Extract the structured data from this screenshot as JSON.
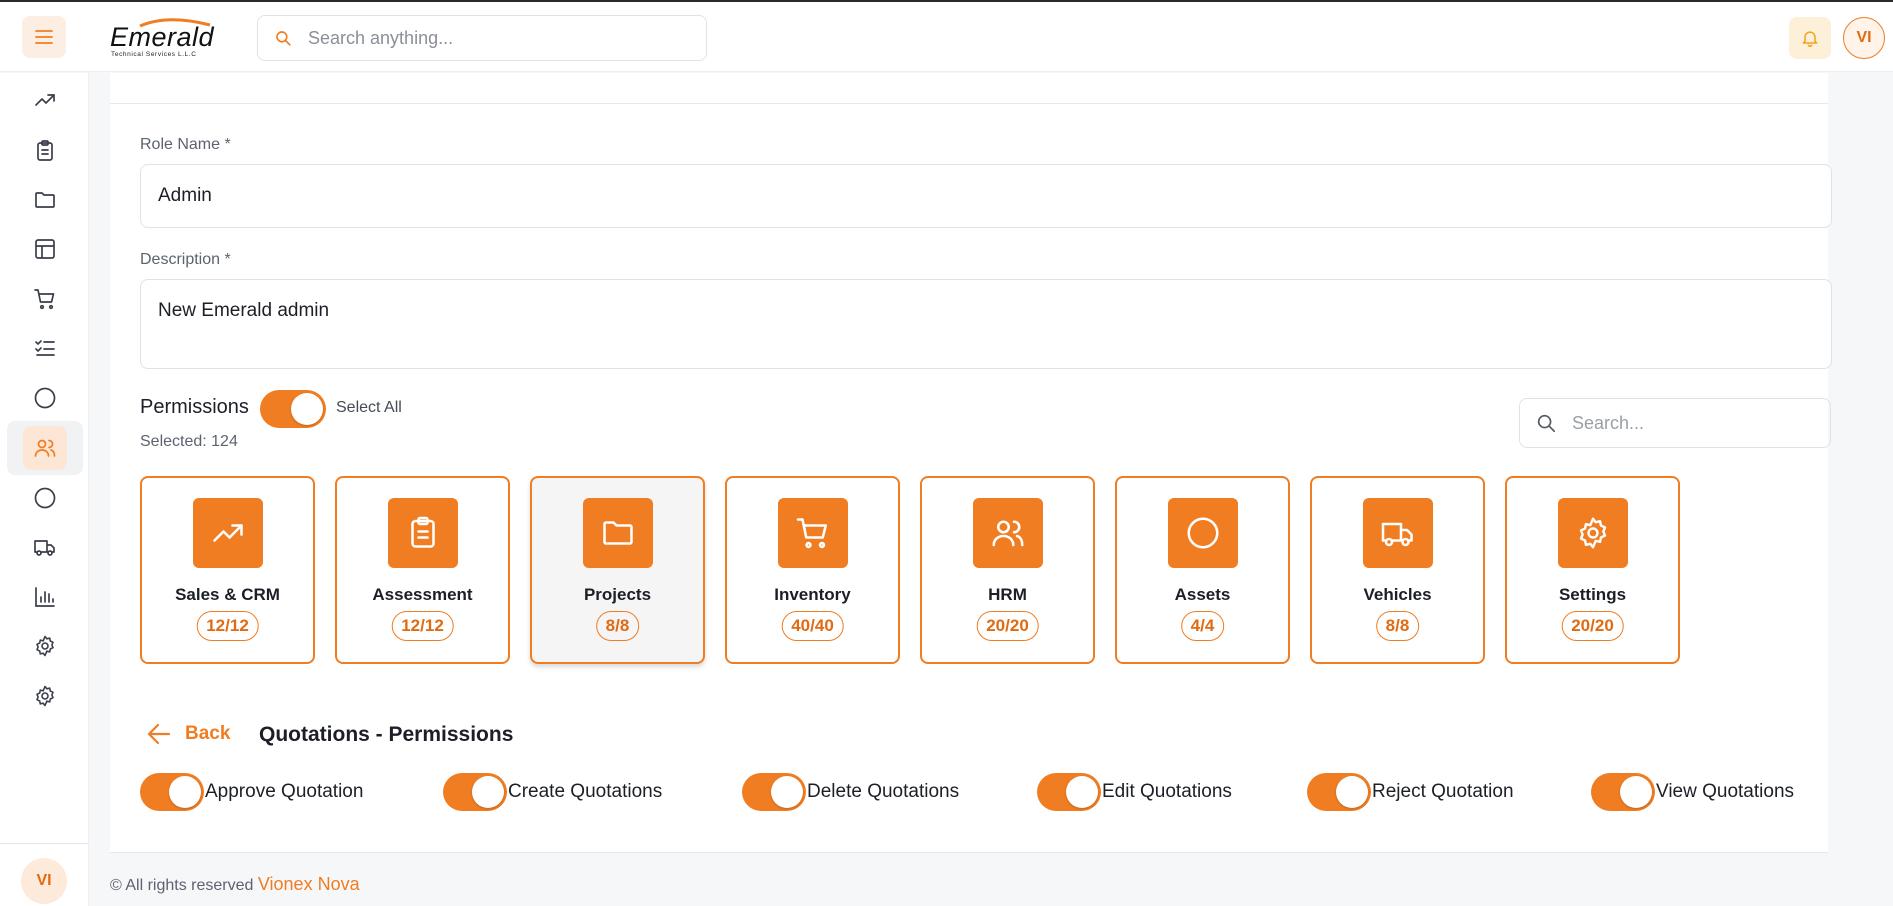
{
  "header": {
    "logo_text": "Emerald",
    "logo_sub": "Technical Services L.L.C",
    "search_placeholder": "Search anything...",
    "user_initials": "VI"
  },
  "sidebar": {
    "items": [
      {
        "icon": "trending-up-icon"
      },
      {
        "icon": "clipboard-icon"
      },
      {
        "icon": "folder-icon"
      },
      {
        "icon": "layout-icon"
      },
      {
        "icon": "cart-icon"
      },
      {
        "icon": "checklist-icon"
      },
      {
        "icon": "circle-icon"
      },
      {
        "icon": "users-icon",
        "active": true
      },
      {
        "icon": "circle-icon"
      },
      {
        "icon": "truck-icon"
      },
      {
        "icon": "bar-chart-icon"
      },
      {
        "icon": "gear-icon"
      },
      {
        "icon": "gear-icon"
      }
    ],
    "user_initials": "VI"
  },
  "form": {
    "role_name_label": "Role Name *",
    "role_name_value": "Admin",
    "description_label": "Description *",
    "description_value": "New Emerald admin",
    "permissions_label": "Permissions",
    "select_all_label": "Select All",
    "selected_text": "Selected: 124",
    "search_placeholder": "Search..."
  },
  "modules": [
    {
      "name": "Sales & CRM",
      "count": "12/12",
      "icon": "trending-up-icon"
    },
    {
      "name": "Assessment",
      "count": "12/12",
      "icon": "clipboard-icon"
    },
    {
      "name": "Projects",
      "count": "8/8",
      "icon": "folder-icon",
      "active": true
    },
    {
      "name": "Inventory",
      "count": "40/40",
      "icon": "cart-icon"
    },
    {
      "name": "HRM",
      "count": "20/20",
      "icon": "users-icon"
    },
    {
      "name": "Assets",
      "count": "4/4",
      "icon": "circle-icon"
    },
    {
      "name": "Vehicles",
      "count": "8/8",
      "icon": "truck-icon"
    },
    {
      "name": "Settings",
      "count": "20/20",
      "icon": "gear-icon"
    }
  ],
  "detail": {
    "back_label": "Back",
    "title": "Quotations - Permissions",
    "permissions": [
      {
        "label": "Approve Quotation",
        "enabled": true
      },
      {
        "label": "Create Quotations",
        "enabled": true
      },
      {
        "label": "Delete Quotations",
        "enabled": true
      },
      {
        "label": "Edit Quotations",
        "enabled": true
      },
      {
        "label": "Reject Quotation",
        "enabled": true
      },
      {
        "label": "View Quotations",
        "enabled": true
      }
    ]
  },
  "footer": {
    "text": "© All rights reserved",
    "brand": "Vionex Nova"
  },
  "colors": {
    "accent": "#f07d21",
    "accent_light": "#fde6d5"
  }
}
